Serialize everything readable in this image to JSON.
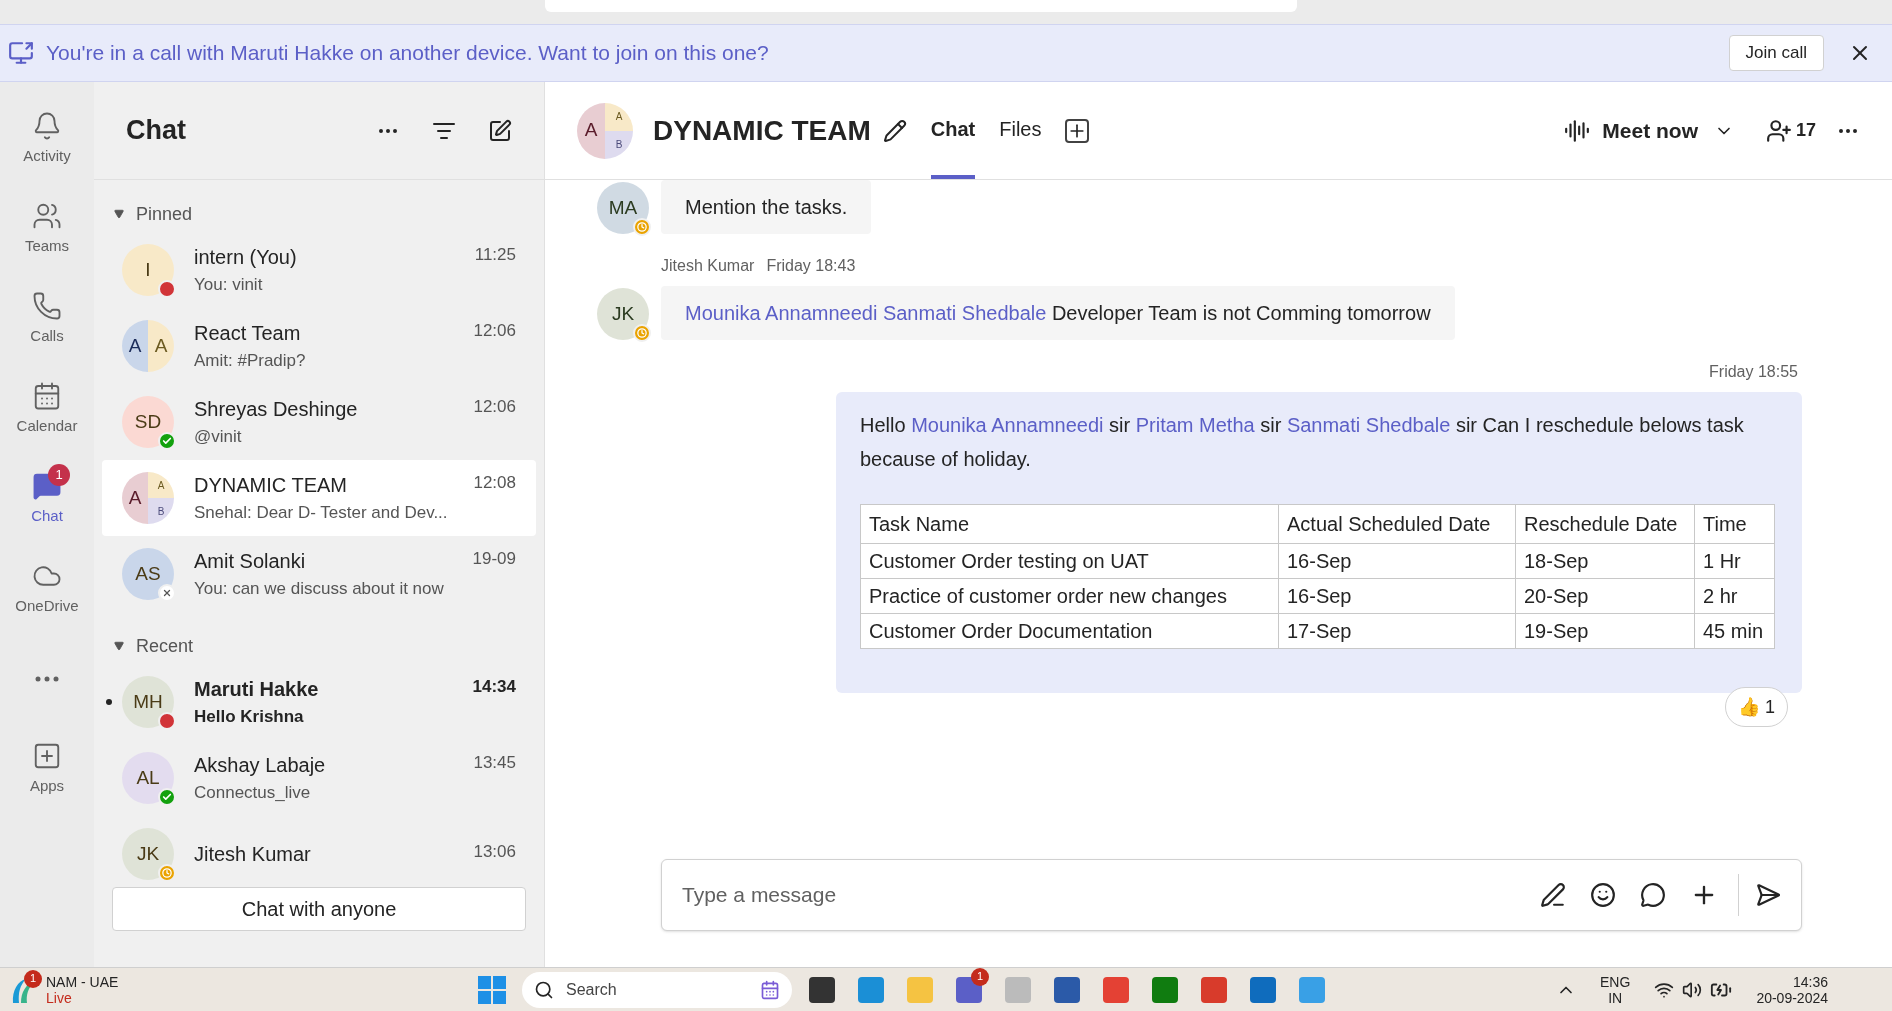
{
  "banner": {
    "text": "You're in a call with Maruti Hakke on another device. Want to join on this one?",
    "button": "Join call"
  },
  "rail": [
    {
      "kind": "bell",
      "label": "Activity",
      "selected": false
    },
    {
      "kind": "teams",
      "label": "Teams",
      "selected": false
    },
    {
      "kind": "phone",
      "label": "Calls",
      "selected": false
    },
    {
      "kind": "calendar",
      "label": "Calendar",
      "selected": false
    },
    {
      "kind": "chat",
      "label": "Chat",
      "selected": true,
      "badge": "1"
    },
    {
      "kind": "cloud",
      "label": "OneDrive",
      "selected": false
    },
    {
      "kind": "more",
      "selected": false
    },
    {
      "kind": "plus",
      "label": "Apps",
      "selected": false
    }
  ],
  "chat_list": {
    "title": "Chat",
    "sections": [
      {
        "label": "Pinned",
        "expanded": true,
        "items": [
          {
            "name": "intern (You)",
            "preview": "You: vinit",
            "time": "11:25",
            "avatar": [
              {
                "initials": "I",
                "color": "#f8e9c8"
              }
            ],
            "presence": {
              "kind": "busy"
            },
            "selected": false,
            "unread": false
          },
          {
            "name": "React Team",
            "preview": "Amit: #Pradip?",
            "time": "12:06",
            "avatar": [
              {
                "initials": "A",
                "color": "#c9d6ea"
              },
              {
                "initials": "A",
                "color": "#f8e9c8"
              }
            ],
            "selected": false,
            "unread": false
          },
          {
            "name": "Shreyas Deshinge",
            "preview": "@vinit",
            "time": "12:06",
            "avatar": [
              {
                "initials": "SD",
                "color": "#fbd9d3"
              }
            ],
            "presence": {
              "kind": "available"
            },
            "selected": false,
            "unread": false
          },
          {
            "name": "DYNAMIC TEAM",
            "preview": "Snehal: Dear  D- Tester and Dev...",
            "time": "12:08",
            "avatar": [
              {
                "initials": "A",
                "color": "#e8cdd2"
              },
              {
                "initials": "A",
                "color": "#f8e9c8"
              },
              {
                "initials": "B",
                "color": "#dedbef"
              }
            ],
            "selected": true,
            "unread": false
          },
          {
            "name": "Amit Solanki",
            "preview": "You: can we discuss about it now",
            "time": "19-09",
            "avatar": [
              {
                "initials": "AS",
                "color": "#c9d6ea"
              }
            ],
            "presence": {
              "kind": "offline"
            },
            "selected": false,
            "unread": false
          }
        ]
      },
      {
        "label": "Recent",
        "expanded": true,
        "items": [
          {
            "name": "Maruti Hakke",
            "preview": "Hello Krishna",
            "time": "14:34",
            "avatar": [
              {
                "initials": "MH",
                "color": "#dfe3d7"
              }
            ],
            "presence": {
              "kind": "busy"
            },
            "selected": false,
            "unread": true
          },
          {
            "name": "Akshay Labaje",
            "preview": "Connectus_live",
            "time": "13:45",
            "avatar": [
              {
                "initials": "AL",
                "color": "#e3dcef"
              }
            ],
            "presence": {
              "kind": "available"
            },
            "selected": false,
            "unread": false
          },
          {
            "name": "Jitesh Kumar",
            "time": "13:06",
            "avatar": [
              {
                "initials": "JK",
                "color": "#dfe3d7"
              }
            ],
            "presence": {
              "kind": "away"
            },
            "selected": false,
            "unread": false
          }
        ]
      }
    ],
    "button": "Chat with anyone"
  },
  "header": {
    "title": "DYNAMIC TEAM",
    "avatar": [
      {
        "initials": "A",
        "color": "#e8cdd2"
      },
      {
        "initials": "A",
        "color": "#f8e9c8"
      },
      {
        "initials": "B",
        "color": "#dedbef"
      }
    ],
    "tabs": [
      {
        "label": "Chat",
        "selected": true
      },
      {
        "label": "Files",
        "selected": false
      }
    ],
    "meet": "Meet now",
    "participants": "17"
  },
  "messages": [
    {
      "kind": "incoming",
      "initials": "MA",
      "color": "#d0dae3",
      "presence": {
        "kind": "away"
      },
      "parts": [
        {
          "kind": "text",
          "text": "Mention the tasks."
        }
      ]
    },
    {
      "kind": "incoming",
      "author": "Jitesh Kumar",
      "time": "Friday 18:43",
      "initials": "JK",
      "color": "#dfe3d7",
      "presence": {
        "kind": "away"
      },
      "parts": [
        {
          "kind": "mention",
          "text": "Mounika Annamneedi Sanmati Shedbale"
        },
        {
          "kind": "text",
          "text": " Developer Team is not Comming tomorrow"
        }
      ]
    },
    {
      "kind": "outgoing",
      "time": "Friday 18:55",
      "parts": [
        {
          "kind": "text",
          "text": "Hello "
        },
        {
          "kind": "mention",
          "text": "Mounika Annamneedi"
        },
        {
          "kind": "text",
          "text": " sir "
        },
        {
          "kind": "mention",
          "text": "Pritam Metha"
        },
        {
          "kind": "text",
          "text": " sir "
        },
        {
          "kind": "mention",
          "text": "Sanmati Shedbale"
        },
        {
          "kind": "text",
          "text": " sir Can I reschedule belows task because of holiday."
        }
      ],
      "table": {
        "columns": [
          "Task Name",
          "Actual Scheduled Date",
          "Reschedule Date",
          "Time"
        ],
        "rows": [
          [
            "Customer Order testing on UAT",
            "16-Sep",
            "18-Sep",
            "1 Hr"
          ],
          [
            "Practice of customer order new changes",
            "16-Sep",
            "20-Sep",
            "2 hr"
          ],
          [
            "Customer Order Documentation",
            "17-Sep",
            "19-Sep",
            "45 min"
          ]
        ]
      },
      "reaction": {
        "emoji": "👍",
        "count": "1"
      }
    }
  ],
  "composer": {
    "placeholder": "Type a message"
  },
  "taskbar": {
    "widget": {
      "title": "NAM - UAE",
      "subtitle": "Live",
      "badge": "1"
    },
    "search": "Search",
    "apps": [
      {
        "kind": "files"
      },
      {
        "kind": "edge"
      },
      {
        "kind": "folder"
      },
      {
        "kind": "teams",
        "badge": "1"
      },
      {
        "kind": "vnc"
      },
      {
        "kind": "store"
      },
      {
        "kind": "chrome"
      },
      {
        "kind": "xbox"
      },
      {
        "kind": "wps"
      },
      {
        "kind": "outlook"
      },
      {
        "kind": "paint"
      }
    ],
    "lang": [
      "ENG",
      "IN"
    ],
    "time": "14:36",
    "date": "20-09-2024"
  }
}
